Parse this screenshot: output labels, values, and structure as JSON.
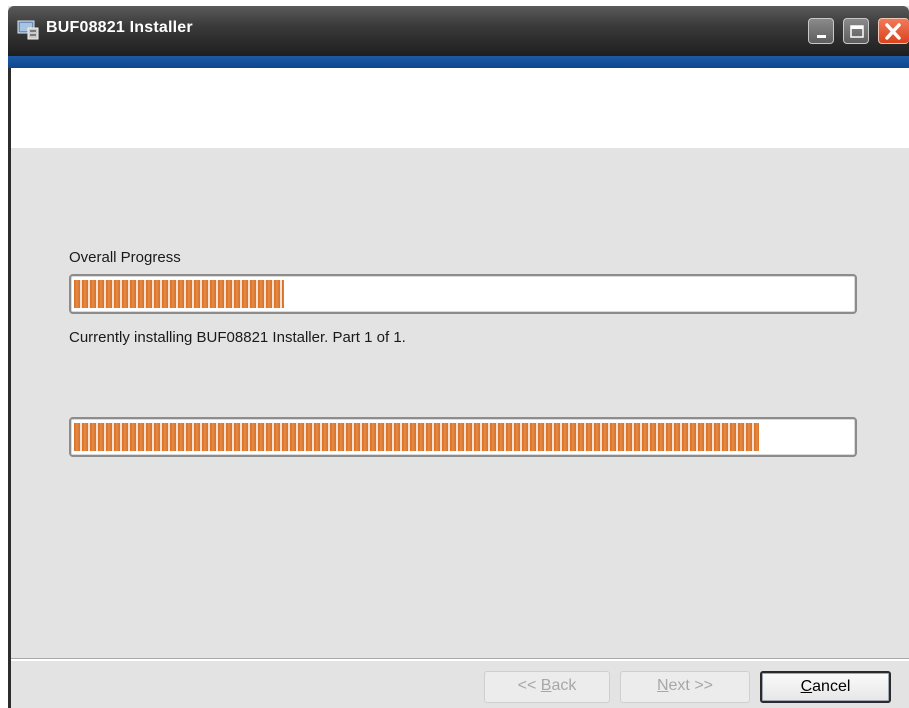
{
  "window": {
    "title": "BUF08821 Installer"
  },
  "title_buttons": {
    "minimize_icon": "minimize-icon",
    "maximize_icon": "maximize-icon",
    "close_icon": "close-icon"
  },
  "progress": {
    "overall_label": "Overall Progress",
    "overall_fraction": 0.27,
    "status_text": "Currently installing BUF08821 Installer.  Part 1 of 1.",
    "current_fraction": 0.88
  },
  "buttons": {
    "back": {
      "prefix": "<< ",
      "accel": "B",
      "rest": "ack",
      "enabled": false
    },
    "next": {
      "prefix": "",
      "accel": "N",
      "rest": "ext >>",
      "enabled": false
    },
    "cancel": {
      "prefix": "",
      "accel": "C",
      "rest": "ancel",
      "enabled": true,
      "default": true
    }
  },
  "colors": {
    "progress_orange": "#d66f26",
    "titlebar": "#2a2a2a",
    "accent_blue": "#0f468c",
    "close_red": "#d9441c"
  }
}
